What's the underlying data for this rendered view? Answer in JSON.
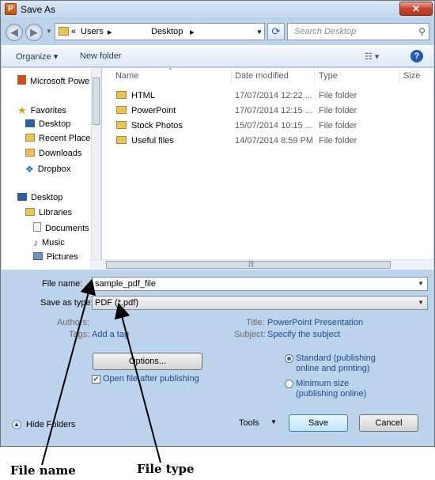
{
  "window": {
    "title": "Save As",
    "close_label": "✕"
  },
  "address_bar": {
    "crumbs": [
      "«",
      "Users",
      "▸",
      "Desktop",
      "▸"
    ],
    "search_placeholder": "Search Desktop"
  },
  "toolbar": {
    "organize": "Organize ▾",
    "new_folder": "New folder",
    "views": "☷ ▾",
    "help": "?"
  },
  "nav_pane": {
    "items": [
      {
        "label": "Microsoft Powe",
        "icon": "powerpoint-icon"
      },
      {
        "label": "Favorites",
        "icon": "star-icon"
      },
      {
        "label": "Desktop",
        "icon": "desktop-icon"
      },
      {
        "label": "Recent Places",
        "icon": "recent-places-icon"
      },
      {
        "label": "Downloads",
        "icon": "downloads-icon"
      },
      {
        "label": "Dropbox",
        "icon": "dropbox-icon"
      },
      {
        "label": "Desktop",
        "icon": "desktop-icon"
      },
      {
        "label": "Libraries",
        "icon": "libraries-icon"
      },
      {
        "label": "Documents",
        "icon": "documents-icon"
      },
      {
        "label": "Music",
        "icon": "music-icon"
      },
      {
        "label": "Pictures",
        "icon": "pictures-icon"
      }
    ]
  },
  "file_list": {
    "columns": [
      "Name",
      "Date modified",
      "Type",
      "Size"
    ],
    "rows": [
      {
        "name": "HTML",
        "date": "17/07/2014 12:22 ...",
        "type": "File folder"
      },
      {
        "name": "PowerPoint",
        "date": "17/07/2014 12:15 ...",
        "type": "File folder"
      },
      {
        "name": "Stock Photos",
        "date": "15/07/2014 10:15 ...",
        "type": "File folder"
      },
      {
        "name": "Useful files",
        "date": "14/07/2014 8:59 PM",
        "type": "File folder"
      }
    ]
  },
  "form": {
    "file_name_label": "File name:",
    "file_name_value": "sample_pdf_file",
    "save_type_label": "Save as type:",
    "save_type_value": "PDF (*.pdf)",
    "authors_label": "Authors:",
    "tags_label": "Tags:",
    "tags_value": "Add a tag",
    "title_label": "Title:",
    "title_value": "PowerPoint Presentation",
    "subject_label": "Subject:",
    "subject_value": "Specify the subject"
  },
  "options": {
    "options_button": "Options...",
    "open_after_label": "Open file after publishing",
    "open_after_checked": true,
    "standard_label": "Standard (publishing online and printing)",
    "minimum_label": "Minimum size (publishing online)",
    "selected": "standard"
  },
  "footer": {
    "hide_folders": "Hide Folders",
    "tools": "Tools",
    "save": "Save",
    "cancel": "Cancel"
  },
  "annotations": {
    "file_name": "File name",
    "file_type": "File type"
  }
}
